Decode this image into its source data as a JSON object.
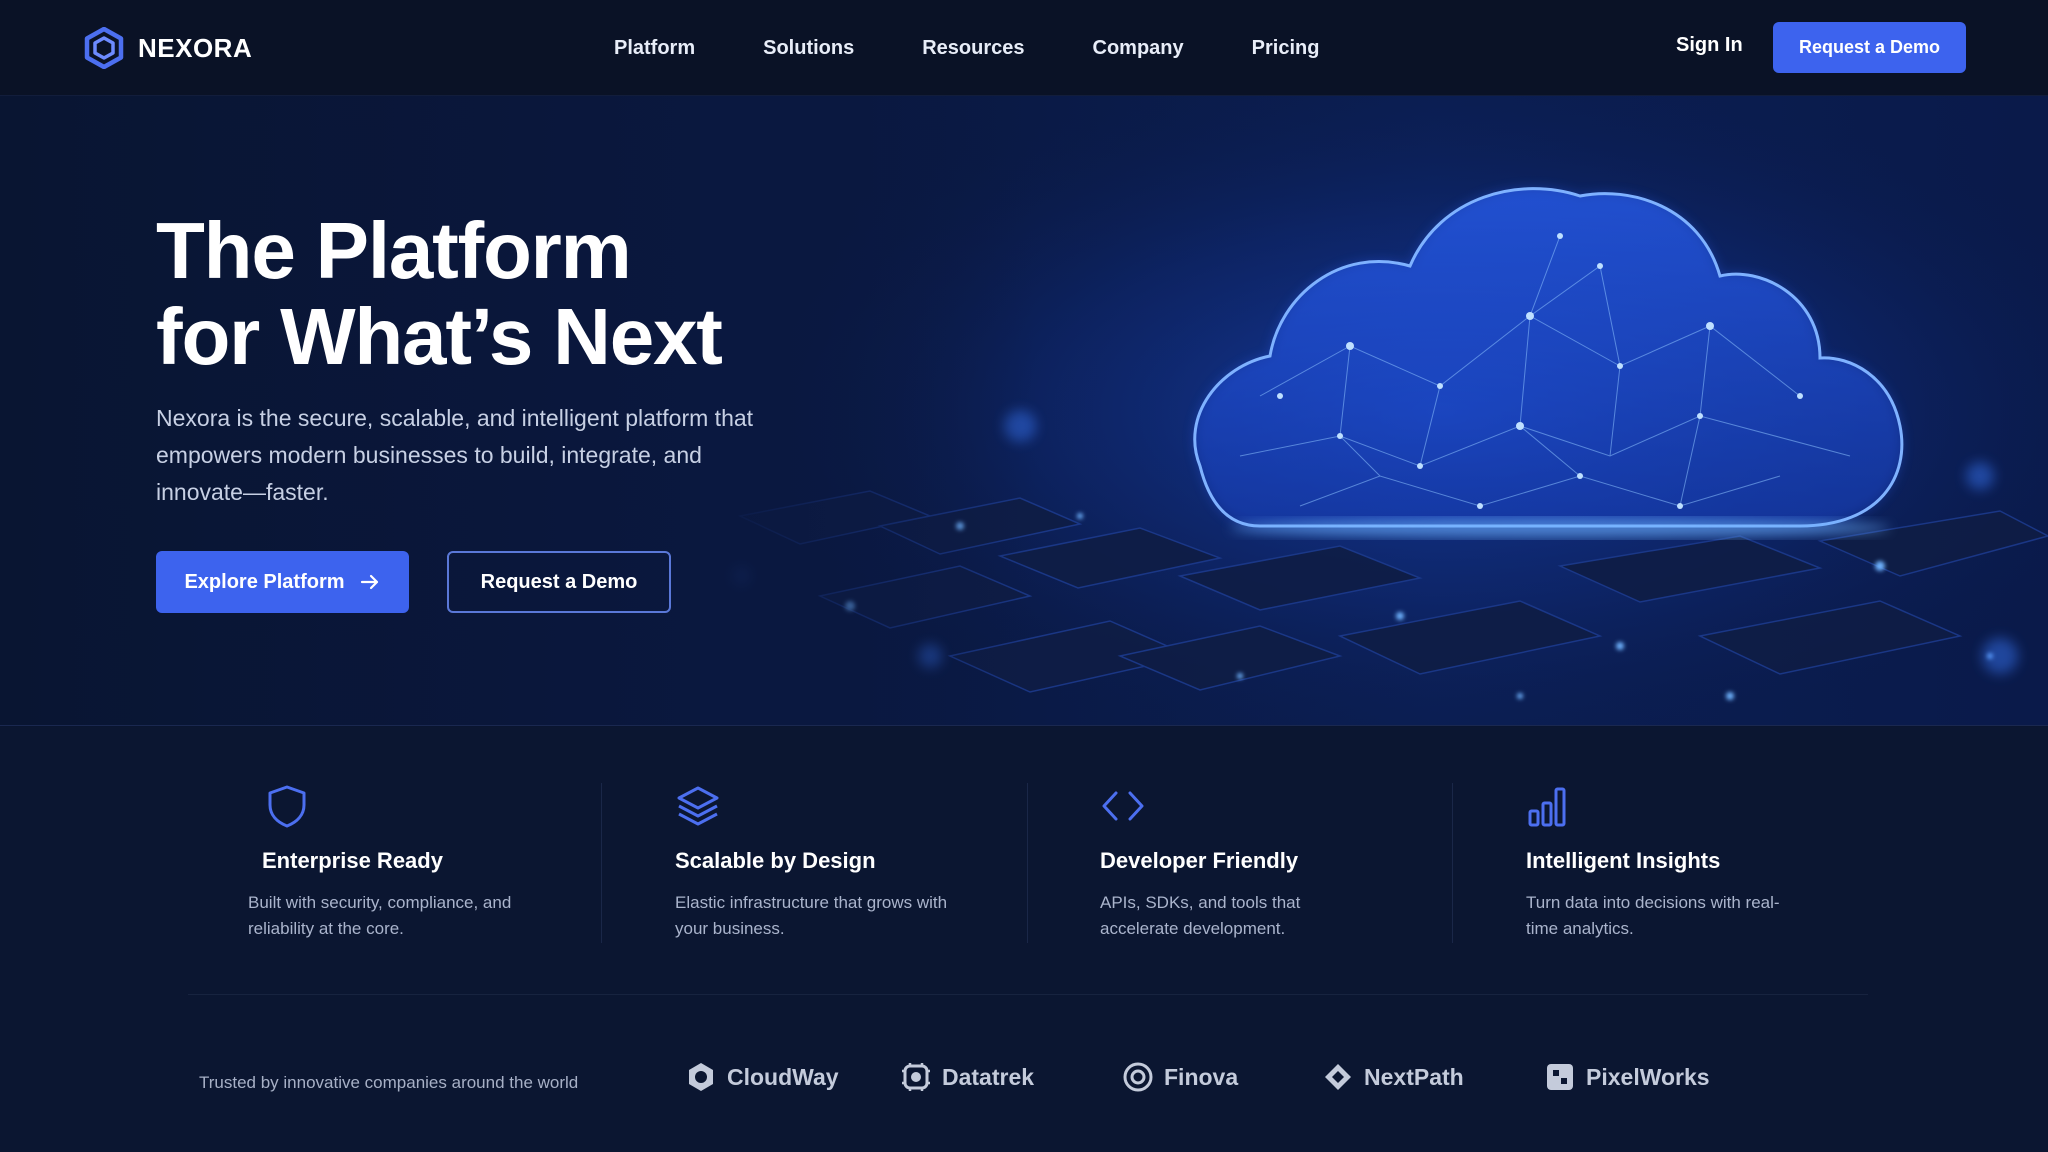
{
  "nav": {
    "logo_text": "NEXORA",
    "links": [
      "Platform",
      "Solutions",
      "Resources",
      "Company",
      "Pricing"
    ],
    "sign_in": "Sign In",
    "cta": "Request a Demo"
  },
  "hero": {
    "title_line1": "The Platform",
    "title_line2": "for What’s Next",
    "subtitle": "Nexora is the secure, scalable, and intelligent platform that empowers modern businesses to build, integrate, and innovate—faster.",
    "primary_cta": "Explore Platform",
    "secondary_cta": "Request a Demo"
  },
  "features": [
    {
      "icon": "shield-icon",
      "title": "Enterprise Ready",
      "desc": "Built with security, compliance, and reliability at the core."
    },
    {
      "icon": "layers-icon",
      "title": "Scalable by Design",
      "desc": "Elastic infrastructure that grows with your business."
    },
    {
      "icon": "code-icon",
      "title": "Developer Friendly",
      "desc": "APIs, SDKs, and tools that accelerate development."
    },
    {
      "icon": "bar-chart-icon",
      "title": "Intelligent Insights",
      "desc": "Turn data into decisions with real-time analytics."
    }
  ],
  "trusted": {
    "text": "Trusted by innovative companies around the world",
    "brands": [
      {
        "name": "CloudWay",
        "icon": "cloudway-logo-icon"
      },
      {
        "name": "Datatrek",
        "icon": "datatrek-logo-icon"
      },
      {
        "name": "Finova",
        "icon": "finova-logo-icon"
      },
      {
        "name": "NextPath",
        "icon": "nextpath-logo-icon"
      },
      {
        "name": "PixelWorks",
        "icon": "pixelworks-logo-icon"
      }
    ]
  },
  "colors": {
    "accent": "#3d63ee",
    "background": "#0a1530",
    "icon": "#4c6ff0"
  }
}
